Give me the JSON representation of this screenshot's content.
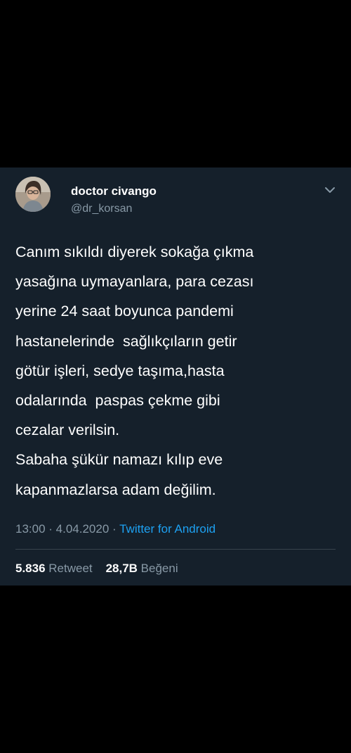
{
  "tweet": {
    "author": {
      "name": "doctor civango",
      "handle": "@dr_korsan",
      "avatar_icon": "profile-photo"
    },
    "more_icon": "chevron-down-icon",
    "text": "Canım sıkıldı diyerek sokağa çıkma\nyasağına uymayanlara, para cezası\nyerine 24 saat boyunca pandemi\nhastanelerinde  sağlıkçıların getir\ngötür işleri, sedye taşıma,hasta\nodalarında  paspas çekme gibi\ncezalar verilsin.\nSabaha şükür namazı kılıp eve\nkapanmazlarsa adam değilim.",
    "time": "13:00",
    "separator": " · ",
    "date": "4.04.2020",
    "source": "Twitter for Android",
    "stats": {
      "retweet_count": "5.836",
      "retweet_label": "Retweet",
      "like_count": "28,7B",
      "like_label": "Beğeni"
    }
  },
  "colors": {
    "page_background": "#000000",
    "card_background": "#15202b",
    "primary_text": "#ffffff",
    "secondary_text": "#8899a6",
    "link": "#1da1f2",
    "divider": "#38444d"
  }
}
